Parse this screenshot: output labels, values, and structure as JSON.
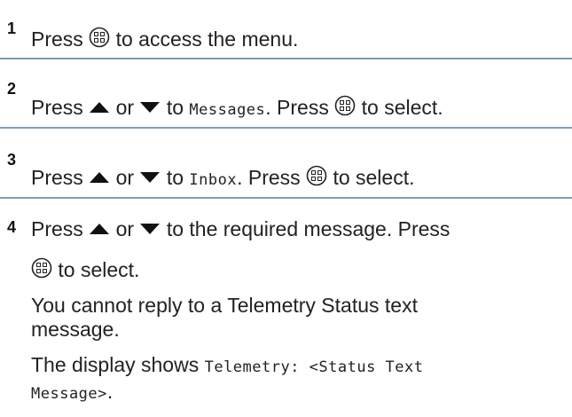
{
  "steps": [
    {
      "number": "1",
      "text_before": "Press",
      "text_after": "to access the menu."
    },
    {
      "number": "2",
      "press": "Press",
      "or": "or",
      "to": "to",
      "target": "Messages",
      "after_target": ". Press",
      "select": "to select."
    },
    {
      "number": "3",
      "press": "Press",
      "or": "or",
      "to": "to",
      "target": "Inbox",
      "after_target": ". Press",
      "select": "to select."
    },
    {
      "number": "4",
      "press": "Press",
      "or": "or",
      "tail": "to the required message. Press",
      "select": "to select.",
      "note": "You cannot reply to a Telemetry Status text message.",
      "display_prefix": "The display shows",
      "display_code_line1": "Telemetry: <Status Text",
      "display_code_line2": "Message>",
      "display_end": "."
    }
  ],
  "icons": {
    "menu_ok_button": "menu-ok-button-icon",
    "up_arrow": "up-arrow-icon",
    "down_arrow": "down-arrow-icon"
  },
  "colors": {
    "separator": "#7f9cb3",
    "text": "#222222"
  }
}
